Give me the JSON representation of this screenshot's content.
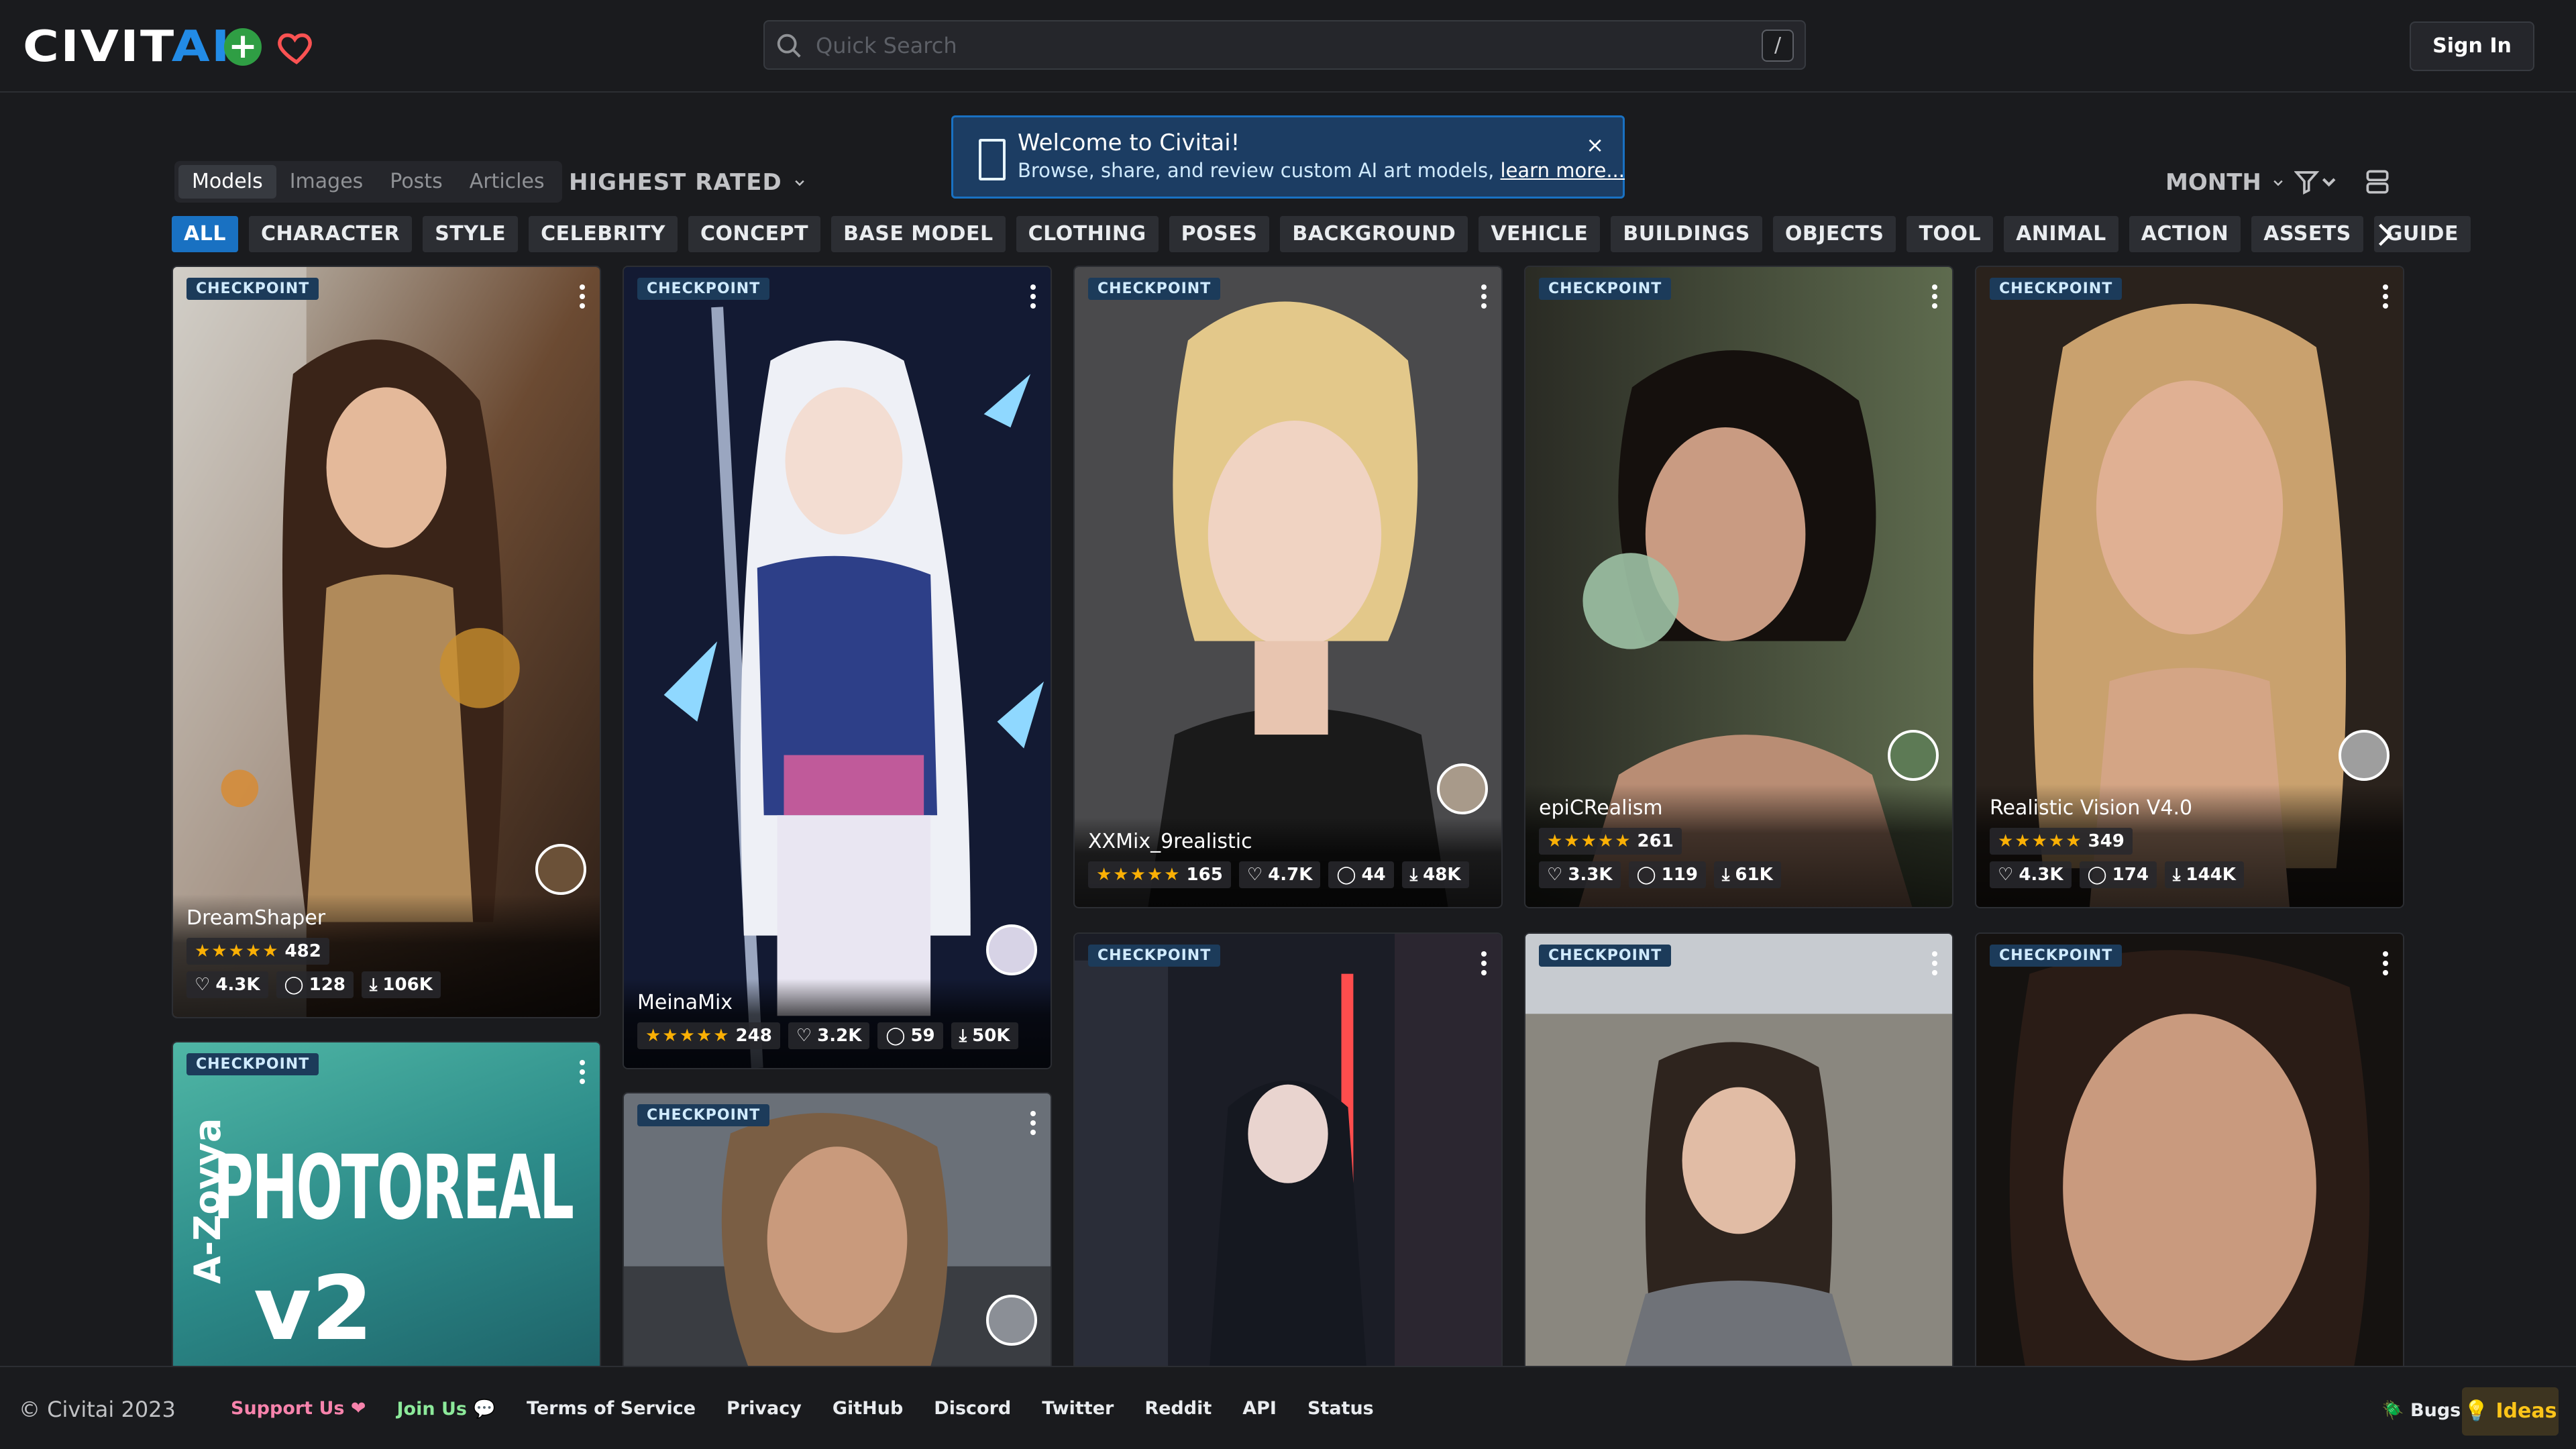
{
  "header": {
    "logo_main": "CIVIT",
    "logo_ai": "AI",
    "search_placeholder": "Quick Search",
    "search_shortcut": "/",
    "signin_label": "Sign In"
  },
  "banner": {
    "title": "Welcome to Civitai!",
    "text": "Browse, share, and review custom AI art models, ",
    "link": "learn more...",
    "close": "×"
  },
  "nav": {
    "tabs": [
      "Models",
      "Images",
      "Posts",
      "Articles"
    ],
    "active_tab": "Models",
    "sort_label": "HIGHEST RATED",
    "period_label": "MONTH"
  },
  "categories": [
    "ALL",
    "CHARACTER",
    "STYLE",
    "CELEBRITY",
    "CONCEPT",
    "BASE MODEL",
    "CLOTHING",
    "POSES",
    "BACKGROUND",
    "VEHICLE",
    "BUILDINGS",
    "OBJECTS",
    "TOOL",
    "ANIMAL",
    "ACTION",
    "ASSETS",
    "GUIDE"
  ],
  "active_category": "ALL",
  "cards": [
    {
      "badge": "CHECKPOINT",
      "name": "DreamShaper",
      "rating": "482",
      "likes": "4.3K",
      "comments": "128",
      "downloads": "106K"
    },
    {
      "badge": "CHECKPOINT",
      "name": "MeinaMix",
      "rating": "248",
      "likes": "3.2K",
      "comments": "59",
      "downloads": "50K"
    },
    {
      "badge": "CHECKPOINT",
      "name": "XXMix_9realistic",
      "rating": "165",
      "likes": "4.7K",
      "comments": "44",
      "downloads": "48K"
    },
    {
      "badge": "CHECKPOINT",
      "name": "epiCRealism",
      "rating": "261",
      "likes": "3.3K",
      "comments": "119",
      "downloads": "61K"
    },
    {
      "badge": "CHECKPOINT",
      "name": "Realistic Vision V4.0",
      "rating": "349",
      "likes": "4.3K",
      "comments": "174",
      "downloads": "144K"
    },
    {
      "badge": "CHECKPOINT",
      "image_text_1": "A-Zovya",
      "image_text_2": "PHOTOREAL",
      "image_text_3": "v2"
    },
    {
      "badge": "CHECKPOINT"
    },
    {
      "badge": "CHECKPOINT"
    },
    {
      "badge": "CHECKPOINT"
    },
    {
      "badge": "CHECKPOINT"
    }
  ],
  "footer": {
    "copyright": "© Civitai 2023",
    "support": "Support Us ❤",
    "join": "Join Us 💬",
    "links": [
      "Terms of Service",
      "Privacy",
      "GitHub",
      "Discord",
      "Twitter",
      "Reddit",
      "API",
      "Status"
    ],
    "bugs": "🪲 Bugs",
    "ideas": "💡 Ideas"
  },
  "colors": {
    "accent": "#1971c2",
    "background": "#1a1b1e",
    "star": "#fab005",
    "support": "#f783ac",
    "join": "#8ce99a"
  }
}
